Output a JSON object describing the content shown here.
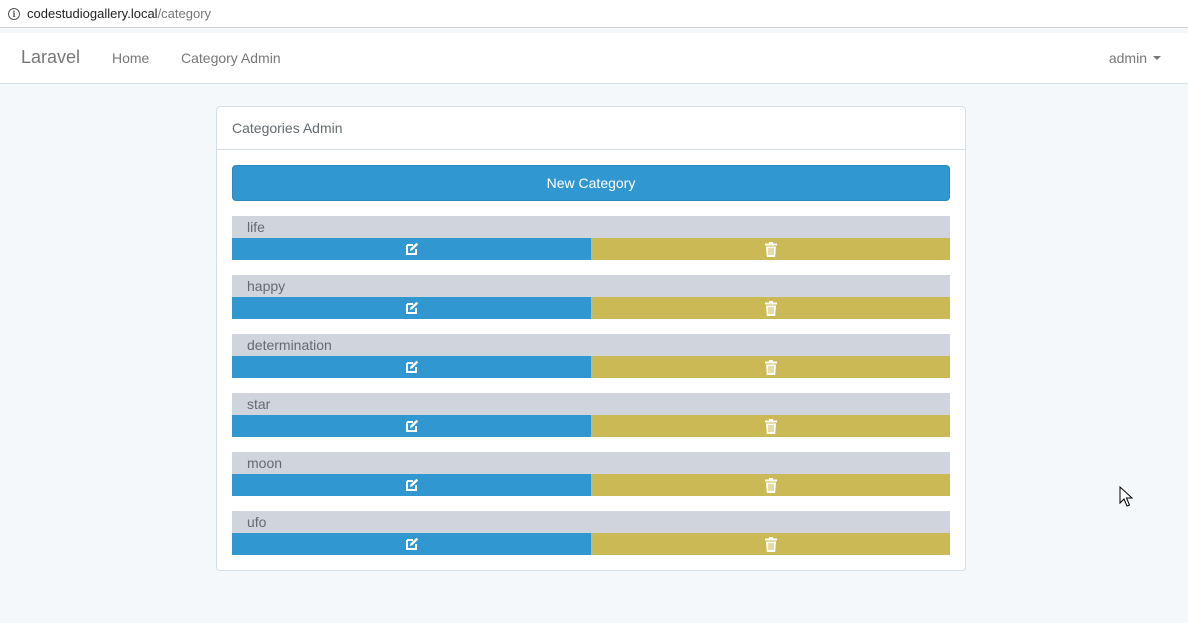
{
  "browser": {
    "url_host": "codestudiogallery.local",
    "url_path": "/category"
  },
  "navbar": {
    "brand": "Laravel",
    "links": [
      "Home",
      "Category Admin"
    ],
    "user": "admin"
  },
  "panel": {
    "title": "Categories Admin",
    "new_button": "New Category"
  },
  "categories": [
    {
      "name": "life"
    },
    {
      "name": "happy"
    },
    {
      "name": "determination"
    },
    {
      "name": "star"
    },
    {
      "name": "moon"
    },
    {
      "name": "ufo"
    }
  ],
  "icons": {
    "edit": "edit-icon",
    "delete": "trash-icon"
  },
  "colors": {
    "primary": "#3097d1",
    "warning": "#cbb956",
    "category_bg": "#d0d5dd",
    "page_bg": "#f5f8fa"
  }
}
